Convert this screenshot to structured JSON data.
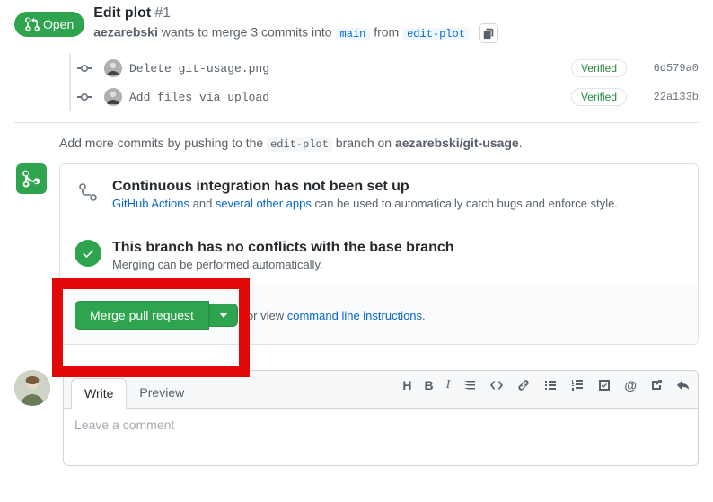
{
  "header": {
    "state": "Open",
    "title": "Edit plot",
    "number": "#1",
    "author": "aezarebski",
    "wants": " wants to merge 3 commits into ",
    "target_branch": "main",
    "from": " from ",
    "source_branch": "edit-plot"
  },
  "commits": [
    {
      "message": "Delete git-usage.png",
      "verified": "Verified",
      "sha": "6d579a0"
    },
    {
      "message": "Add files via upload",
      "verified": "Verified",
      "sha": "22a133b"
    }
  ],
  "push_hint": {
    "prefix": "Add more commits by pushing to the ",
    "branch": "edit-plot",
    "mid": " branch on ",
    "repo": "aezarebski/git-usage",
    "suffix": "."
  },
  "merge": {
    "ci_title": "Continuous integration has not been set up",
    "ci_link1": "GitHub Actions",
    "ci_and": " and ",
    "ci_link2": "several other apps",
    "ci_rest": " can be used to automatically catch bugs and enforce style.",
    "conflict_title": "This branch has no conflicts with the base branch",
    "conflict_sub": "Merging can be performed automatically.",
    "button": "Merge pull request",
    "or": "or view ",
    "cli": "command line instructions",
    "dot": "."
  },
  "comment": {
    "tab_write": "Write",
    "tab_preview": "Preview",
    "placeholder": "Leave a comment"
  }
}
